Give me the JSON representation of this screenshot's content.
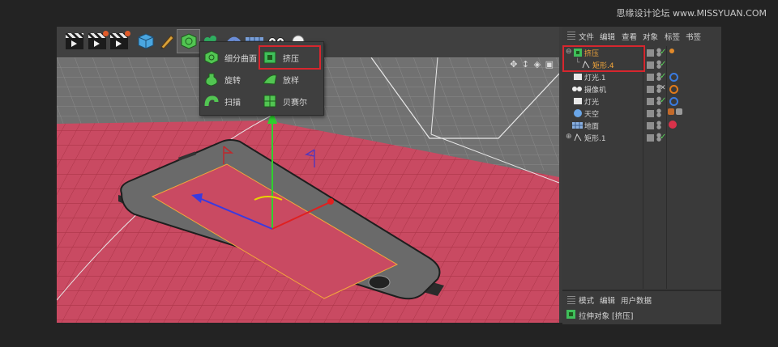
{
  "watermark": "思缘设计论坛 www.MISSYUAN.COM",
  "popup_menu": {
    "items": [
      {
        "label": "细分曲面",
        "icon": "subdivision-surface-icon"
      },
      {
        "label": "挤压",
        "icon": "extrude-icon"
      },
      {
        "label": "旋转",
        "icon": "lathe-icon"
      },
      {
        "label": "放样",
        "icon": "loft-icon"
      },
      {
        "label": "扫描",
        "icon": "sweep-icon"
      },
      {
        "label": "贝赛尔",
        "icon": "bezier-icon"
      }
    ],
    "highlighted": "挤压"
  },
  "object_manager": {
    "menu": [
      "文件",
      "编辑",
      "查看",
      "对象",
      "标签",
      "书签"
    ],
    "objects": [
      {
        "name": "挤压",
        "icon": "extrude-icon",
        "active": true
      },
      {
        "name": "矩形.4",
        "icon": "spline-icon",
        "active": true,
        "child": true
      },
      {
        "name": "灯光.1",
        "icon": "light-icon"
      },
      {
        "name": "摄像机",
        "icon": "camera-icon"
      },
      {
        "name": "灯光",
        "icon": "light-icon"
      },
      {
        "name": "天空",
        "icon": "sky-icon"
      },
      {
        "name": "地面",
        "icon": "floor-icon"
      },
      {
        "name": "矩形.1",
        "icon": "spline-icon"
      }
    ]
  },
  "attributes": {
    "menu": [
      "模式",
      "编辑",
      "用户数据"
    ],
    "object_label": "拉伸对象 [挤压]"
  },
  "colors": {
    "highlight": "#d7262e",
    "floor": "#c94a62",
    "active_text": "#f3a73a",
    "check_green": "#5ad25a",
    "axis_green": "#2ed12e",
    "axis_red": "#e02020",
    "axis_blue": "#3a3ae0"
  }
}
